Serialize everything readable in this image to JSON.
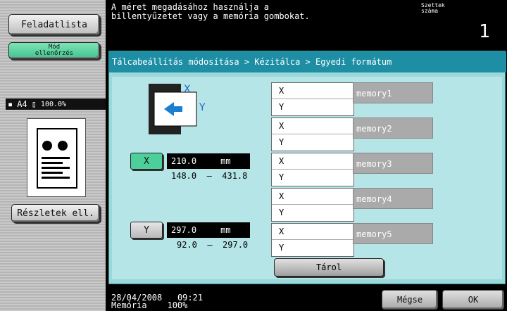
{
  "left": {
    "job_list": "Feladatlista",
    "proof_copy": "Mód\nellenőrzés",
    "status": {
      "paper": "A4",
      "zoom": "100.0%"
    },
    "details": "Részletek ell."
  },
  "header": {
    "message": "A méret megadásához használja a\nbillentyűzetet vagy a memória gombokat.",
    "copies_label": "Szettek\nszáma",
    "copies_value": "1"
  },
  "breadcrumb": "Tálcabeállítás módosítása > Kézitálca > Egyedi formátum",
  "size": {
    "x": {
      "label": "X",
      "value": "210.0",
      "unit": "mm",
      "range": "148.0  –  431.8"
    },
    "y": {
      "label": "Y",
      "value": "297.0",
      "unit": "mm",
      "range": "92.0  –  297.0"
    }
  },
  "diagram": {
    "x_label": "X",
    "y_label": "Y"
  },
  "memories": [
    {
      "x": "X",
      "y": "Y",
      "label": "memory1"
    },
    {
      "x": "X",
      "y": "Y",
      "label": "memory2"
    },
    {
      "x": "X",
      "y": "Y",
      "label": "memory3"
    },
    {
      "x": "X",
      "y": "Y",
      "label": "memory4"
    },
    {
      "x": "X",
      "y": "Y",
      "label": "memory5"
    }
  ],
  "store": "Tárol",
  "footer": {
    "date": "28/04/2008",
    "time": "09:21",
    "memory_label": "Memória",
    "memory_value": "100%",
    "cancel": "Mégse",
    "ok": "OK"
  }
}
